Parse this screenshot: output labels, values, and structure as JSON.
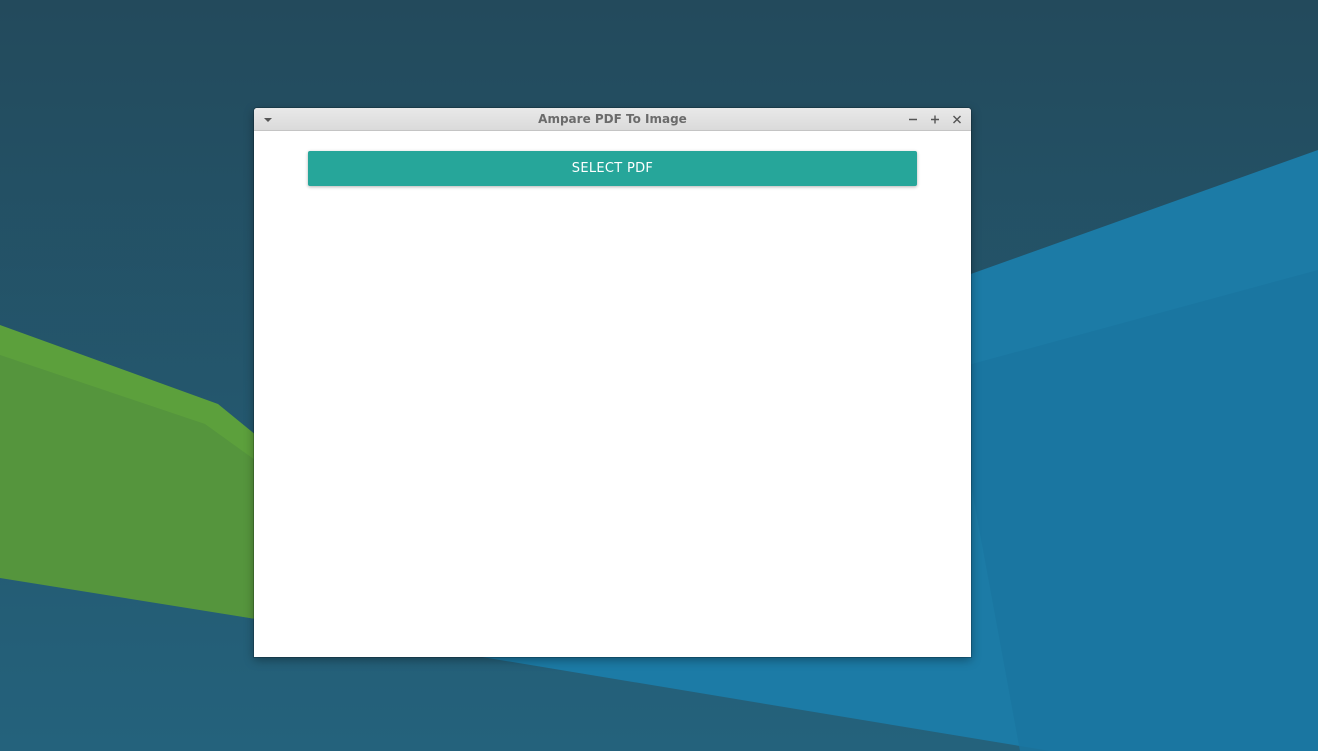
{
  "window": {
    "title": "Ampare PDF To Image",
    "controls": {
      "menu_icon": "chevron-down-icon",
      "minimize_icon": "minimize-icon",
      "maximize_icon": "maximize-icon",
      "close_icon": "close-icon"
    }
  },
  "main": {
    "select_pdf_label": "SELECT PDF"
  },
  "colors": {
    "button_accent": "#26a69a",
    "desktop_base": "#235063",
    "desktop_blue": "#1b7aa6",
    "desktop_green": "#55973d"
  }
}
